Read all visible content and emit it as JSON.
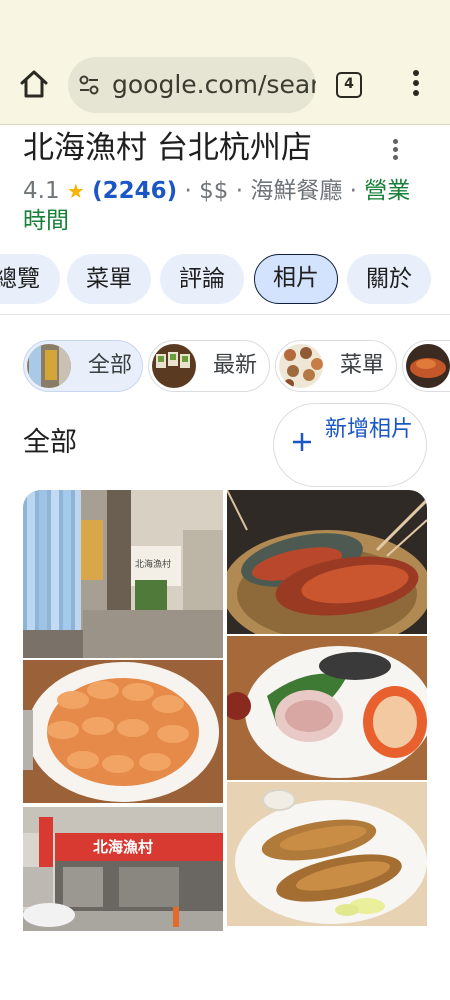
{
  "browser": {
    "url": "google.com/search",
    "tab_count": "4"
  },
  "place": {
    "name": "北海漁村 台北杭州店",
    "rating": "4.1",
    "star": "★",
    "reviews": "(2246)",
    "price": "$$",
    "category": "海鮮餐廳",
    "status": "營業時間"
  },
  "tabs": [
    "總覽",
    "菜單",
    "評論",
    "相片",
    "關於"
  ],
  "active_tab": "相片",
  "chips": [
    {
      "label": "全部",
      "active": true
    },
    {
      "label": "最新",
      "active": false
    },
    {
      "label": "菜單",
      "active": false
    }
  ],
  "section": {
    "title": "全部",
    "add_button": "新增相片"
  },
  "photos": [
    {
      "name": "restaurant-interior-photo",
      "sign": "北海漁村"
    },
    {
      "name": "lobster-basket-photo"
    },
    {
      "name": "shrimp-plate-photo"
    },
    {
      "name": "seafood-platter-photo"
    },
    {
      "name": "restaurant-exterior-photo",
      "sign": "北海漁村"
    },
    {
      "name": "fried-fish-photo"
    }
  ],
  "colors": {
    "accent_blue": "#1a57c4",
    "status_green": "#188038",
    "star_yellow": "#f4b400",
    "chrome_bg": "#f8f6e3"
  }
}
